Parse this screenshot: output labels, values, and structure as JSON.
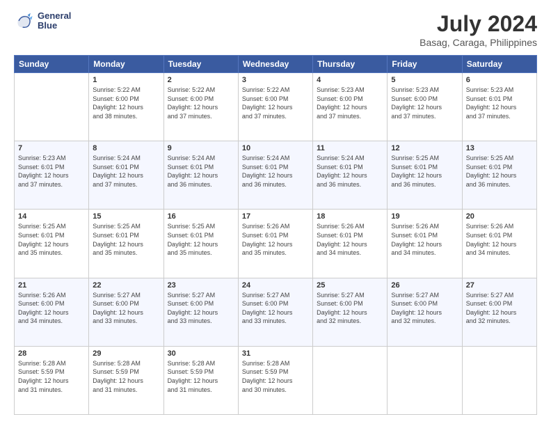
{
  "header": {
    "logo_line1": "General",
    "logo_line2": "Blue",
    "month_year": "July 2024",
    "location": "Basag, Caraga, Philippines"
  },
  "columns": [
    "Sunday",
    "Monday",
    "Tuesday",
    "Wednesday",
    "Thursday",
    "Friday",
    "Saturday"
  ],
  "weeks": [
    [
      {
        "day": "",
        "info": ""
      },
      {
        "day": "1",
        "info": "Sunrise: 5:22 AM\nSunset: 6:00 PM\nDaylight: 12 hours\nand 38 minutes."
      },
      {
        "day": "2",
        "info": "Sunrise: 5:22 AM\nSunset: 6:00 PM\nDaylight: 12 hours\nand 37 minutes."
      },
      {
        "day": "3",
        "info": "Sunrise: 5:22 AM\nSunset: 6:00 PM\nDaylight: 12 hours\nand 37 minutes."
      },
      {
        "day": "4",
        "info": "Sunrise: 5:23 AM\nSunset: 6:00 PM\nDaylight: 12 hours\nand 37 minutes."
      },
      {
        "day": "5",
        "info": "Sunrise: 5:23 AM\nSunset: 6:00 PM\nDaylight: 12 hours\nand 37 minutes."
      },
      {
        "day": "6",
        "info": "Sunrise: 5:23 AM\nSunset: 6:01 PM\nDaylight: 12 hours\nand 37 minutes."
      }
    ],
    [
      {
        "day": "7",
        "info": "Sunrise: 5:23 AM\nSunset: 6:01 PM\nDaylight: 12 hours\nand 37 minutes."
      },
      {
        "day": "8",
        "info": "Sunrise: 5:24 AM\nSunset: 6:01 PM\nDaylight: 12 hours\nand 37 minutes."
      },
      {
        "day": "9",
        "info": "Sunrise: 5:24 AM\nSunset: 6:01 PM\nDaylight: 12 hours\nand 36 minutes."
      },
      {
        "day": "10",
        "info": "Sunrise: 5:24 AM\nSunset: 6:01 PM\nDaylight: 12 hours\nand 36 minutes."
      },
      {
        "day": "11",
        "info": "Sunrise: 5:24 AM\nSunset: 6:01 PM\nDaylight: 12 hours\nand 36 minutes."
      },
      {
        "day": "12",
        "info": "Sunrise: 5:25 AM\nSunset: 6:01 PM\nDaylight: 12 hours\nand 36 minutes."
      },
      {
        "day": "13",
        "info": "Sunrise: 5:25 AM\nSunset: 6:01 PM\nDaylight: 12 hours\nand 36 minutes."
      }
    ],
    [
      {
        "day": "14",
        "info": "Sunrise: 5:25 AM\nSunset: 6:01 PM\nDaylight: 12 hours\nand 35 minutes."
      },
      {
        "day": "15",
        "info": "Sunrise: 5:25 AM\nSunset: 6:01 PM\nDaylight: 12 hours\nand 35 minutes."
      },
      {
        "day": "16",
        "info": "Sunrise: 5:25 AM\nSunset: 6:01 PM\nDaylight: 12 hours\nand 35 minutes."
      },
      {
        "day": "17",
        "info": "Sunrise: 5:26 AM\nSunset: 6:01 PM\nDaylight: 12 hours\nand 35 minutes."
      },
      {
        "day": "18",
        "info": "Sunrise: 5:26 AM\nSunset: 6:01 PM\nDaylight: 12 hours\nand 34 minutes."
      },
      {
        "day": "19",
        "info": "Sunrise: 5:26 AM\nSunset: 6:01 PM\nDaylight: 12 hours\nand 34 minutes."
      },
      {
        "day": "20",
        "info": "Sunrise: 5:26 AM\nSunset: 6:01 PM\nDaylight: 12 hours\nand 34 minutes."
      }
    ],
    [
      {
        "day": "21",
        "info": "Sunrise: 5:26 AM\nSunset: 6:00 PM\nDaylight: 12 hours\nand 34 minutes."
      },
      {
        "day": "22",
        "info": "Sunrise: 5:27 AM\nSunset: 6:00 PM\nDaylight: 12 hours\nand 33 minutes."
      },
      {
        "day": "23",
        "info": "Sunrise: 5:27 AM\nSunset: 6:00 PM\nDaylight: 12 hours\nand 33 minutes."
      },
      {
        "day": "24",
        "info": "Sunrise: 5:27 AM\nSunset: 6:00 PM\nDaylight: 12 hours\nand 33 minutes."
      },
      {
        "day": "25",
        "info": "Sunrise: 5:27 AM\nSunset: 6:00 PM\nDaylight: 12 hours\nand 32 minutes."
      },
      {
        "day": "26",
        "info": "Sunrise: 5:27 AM\nSunset: 6:00 PM\nDaylight: 12 hours\nand 32 minutes."
      },
      {
        "day": "27",
        "info": "Sunrise: 5:27 AM\nSunset: 6:00 PM\nDaylight: 12 hours\nand 32 minutes."
      }
    ],
    [
      {
        "day": "28",
        "info": "Sunrise: 5:28 AM\nSunset: 5:59 PM\nDaylight: 12 hours\nand 31 minutes."
      },
      {
        "day": "29",
        "info": "Sunrise: 5:28 AM\nSunset: 5:59 PM\nDaylight: 12 hours\nand 31 minutes."
      },
      {
        "day": "30",
        "info": "Sunrise: 5:28 AM\nSunset: 5:59 PM\nDaylight: 12 hours\nand 31 minutes."
      },
      {
        "day": "31",
        "info": "Sunrise: 5:28 AM\nSunset: 5:59 PM\nDaylight: 12 hours\nand 30 minutes."
      },
      {
        "day": "",
        "info": ""
      },
      {
        "day": "",
        "info": ""
      },
      {
        "day": "",
        "info": ""
      }
    ]
  ]
}
